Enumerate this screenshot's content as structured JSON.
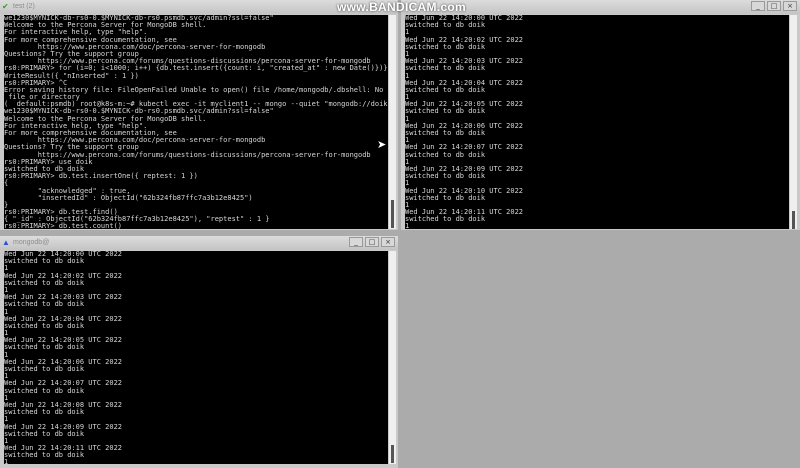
{
  "watermark": "www.BANDICAM.com",
  "win1": {
    "title": "test (2)",
    "lines": [
      "we1230$MYNICK-db-rs0-0.$MYNICK-db-rs0.psmdb.svc/admin?ssl=false\"",
      "Welcome to the Percona Server for MongoDB shell.",
      "For interactive help, type \"help\".",
      "For more comprehensive documentation, see",
      "        https://www.percona.com/doc/percona-server-for-mongodb",
      "Questions? Try the support group",
      "        https://www.percona.com/forums/questions-discussions/percona-server-for-mongodb",
      "rs0:PRIMARY> for (i=0; i<1000; i++) {db.test.insert({count: i, \"created_at\" : new Date()})}",
      "WriteResult({ \"nInserted\" : 1 })",
      "rs0:PRIMARY> ^C",
      "Error saving history file: FileOpenFailed Unable to open() file /home/mongodb/.dbshell: No such",
      " file or directory",
      "(  default:psmdb) root@k8s-m:~# kubectl exec -it myclient1 -- mongo --quiet \"mongodb://doik:q",
      "we1230$MYNICK-db-rs0-0.$MYNICK-db-rs0.psmdb.svc/admin?ssl=false\"",
      "Welcome to the Percona Server for MongoDB shell.",
      "For interactive help, type \"help\".",
      "For more comprehensive documentation, see",
      "        https://www.percona.com/doc/percona-server-for-mongodb",
      "Questions? Try the support group",
      "        https://www.percona.com/forums/questions-discussions/percona-server-for-mongodb",
      "rs0:PRIMARY> use doik",
      "switched to db doik",
      "rs0:PRIMARY> db.test.insertOne({ reptest: 1 })",
      "{",
      "        \"acknowledged\" : true,",
      "        \"insertedId\" : ObjectId(\"62b324fb87ffc7a3b12e8425\")",
      "}",
      "rs0:PRIMARY> db.test.find()",
      "{ \"_id\" : ObjectId(\"62b324fb87ffc7a3b12e8425\"), \"reptest\" : 1 }",
      "rs0:PRIMARY> db.test.count()",
      "1",
      "rs0:PRIMARY> "
    ]
  },
  "win2": {
    "title": "",
    "lines": [
      "Wed Jun 22 14:20:00 UTC 2022",
      "switched to db doik",
      "1",
      "Wed Jun 22 14:20:02 UTC 2022",
      "switched to db doik",
      "1",
      "Wed Jun 22 14:20:03 UTC 2022",
      "switched to db doik",
      "1",
      "Wed Jun 22 14:20:04 UTC 2022",
      "switched to db doik",
      "1",
      "Wed Jun 22 14:20:05 UTC 2022",
      "switched to db doik",
      "1",
      "Wed Jun 22 14:20:06 UTC 2022",
      "switched to db doik",
      "1",
      "Wed Jun 22 14:20:07 UTC 2022",
      "switched to db doik",
      "1",
      "Wed Jun 22 14:20:09 UTC 2022",
      "switched to db doik",
      "1",
      "Wed Jun 22 14:20:10 UTC 2022",
      "switched to db doik",
      "1",
      "Wed Jun 22 14:20:11 UTC 2022",
      "switched to db doik",
      "1",
      "Wed Jun 22 14:20:12 UTC 2022"
    ]
  },
  "win3": {
    "title": "mongodb@",
    "lines": [
      "Wed Jun 22 14:20:00 UTC 2022",
      "switched to db doik",
      "1",
      "Wed Jun 22 14:20:02 UTC 2022",
      "switched to db doik",
      "1",
      "Wed Jun 22 14:20:03 UTC 2022",
      "switched to db doik",
      "1",
      "Wed Jun 22 14:20:04 UTC 2022",
      "switched to db doik",
      "1",
      "Wed Jun 22 14:20:05 UTC 2022",
      "switched to db doik",
      "1",
      "Wed Jun 22 14:20:06 UTC 2022",
      "switched to db doik",
      "1",
      "Wed Jun 22 14:20:07 UTC 2022",
      "switched to db doik",
      "1",
      "Wed Jun 22 14:20:08 UTC 2022",
      "switched to db doik",
      "1",
      "Wed Jun 22 14:20:09 UTC 2022",
      "switched to db doik",
      "1",
      "Wed Jun 22 14:20:11 UTC 2022",
      "switched to db doik",
      "1",
      "Wed Jun 22 14:20:12 UTC 2022"
    ]
  },
  "controls": {
    "minimize": "_",
    "maximize": "□",
    "close": "×"
  }
}
